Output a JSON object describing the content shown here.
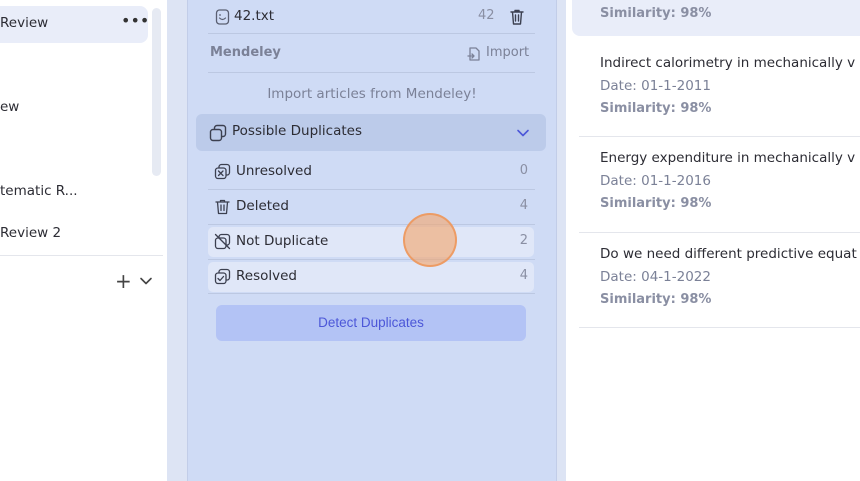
{
  "sidebar": {
    "items": [
      {
        "label": "Review"
      },
      {
        "label": "ew"
      },
      {
        "label": "tematic R..."
      },
      {
        "label": "Review 2"
      }
    ]
  },
  "middle": {
    "file": {
      "name": "42.txt",
      "count": "42"
    },
    "mendeley_label": "Mendeley",
    "import_label": "Import",
    "import_text": "Import articles from Mendeley!",
    "duplicates_title": "Possible Duplicates",
    "statuses": [
      {
        "label": "Unresolved",
        "count": "0"
      },
      {
        "label": "Deleted",
        "count": "4"
      },
      {
        "label": "Not Duplicate",
        "count": "2"
      },
      {
        "label": "Resolved",
        "count": "4"
      }
    ],
    "detect_button": "Detect Duplicates"
  },
  "articles": {
    "top_similarity": "Similarity: 98%",
    "items": [
      {
        "title": "Indirect calorimetry in mechanically v",
        "date": "Date: 01-1-2011",
        "similarity": "Similarity: 98%"
      },
      {
        "title": "Energy expenditure in mechanically v",
        "date": "Date: 01-1-2016",
        "similarity": "Similarity: 98%"
      },
      {
        "title": "Do we need different predictive equat",
        "date": "Date: 04-1-2022",
        "similarity": "Similarity: 98%"
      }
    ]
  },
  "colors": {
    "panel": "#cfdbf5",
    "accent": "#4c57d8",
    "button": "#b3c3f5",
    "cursor": "#f4a66e"
  }
}
